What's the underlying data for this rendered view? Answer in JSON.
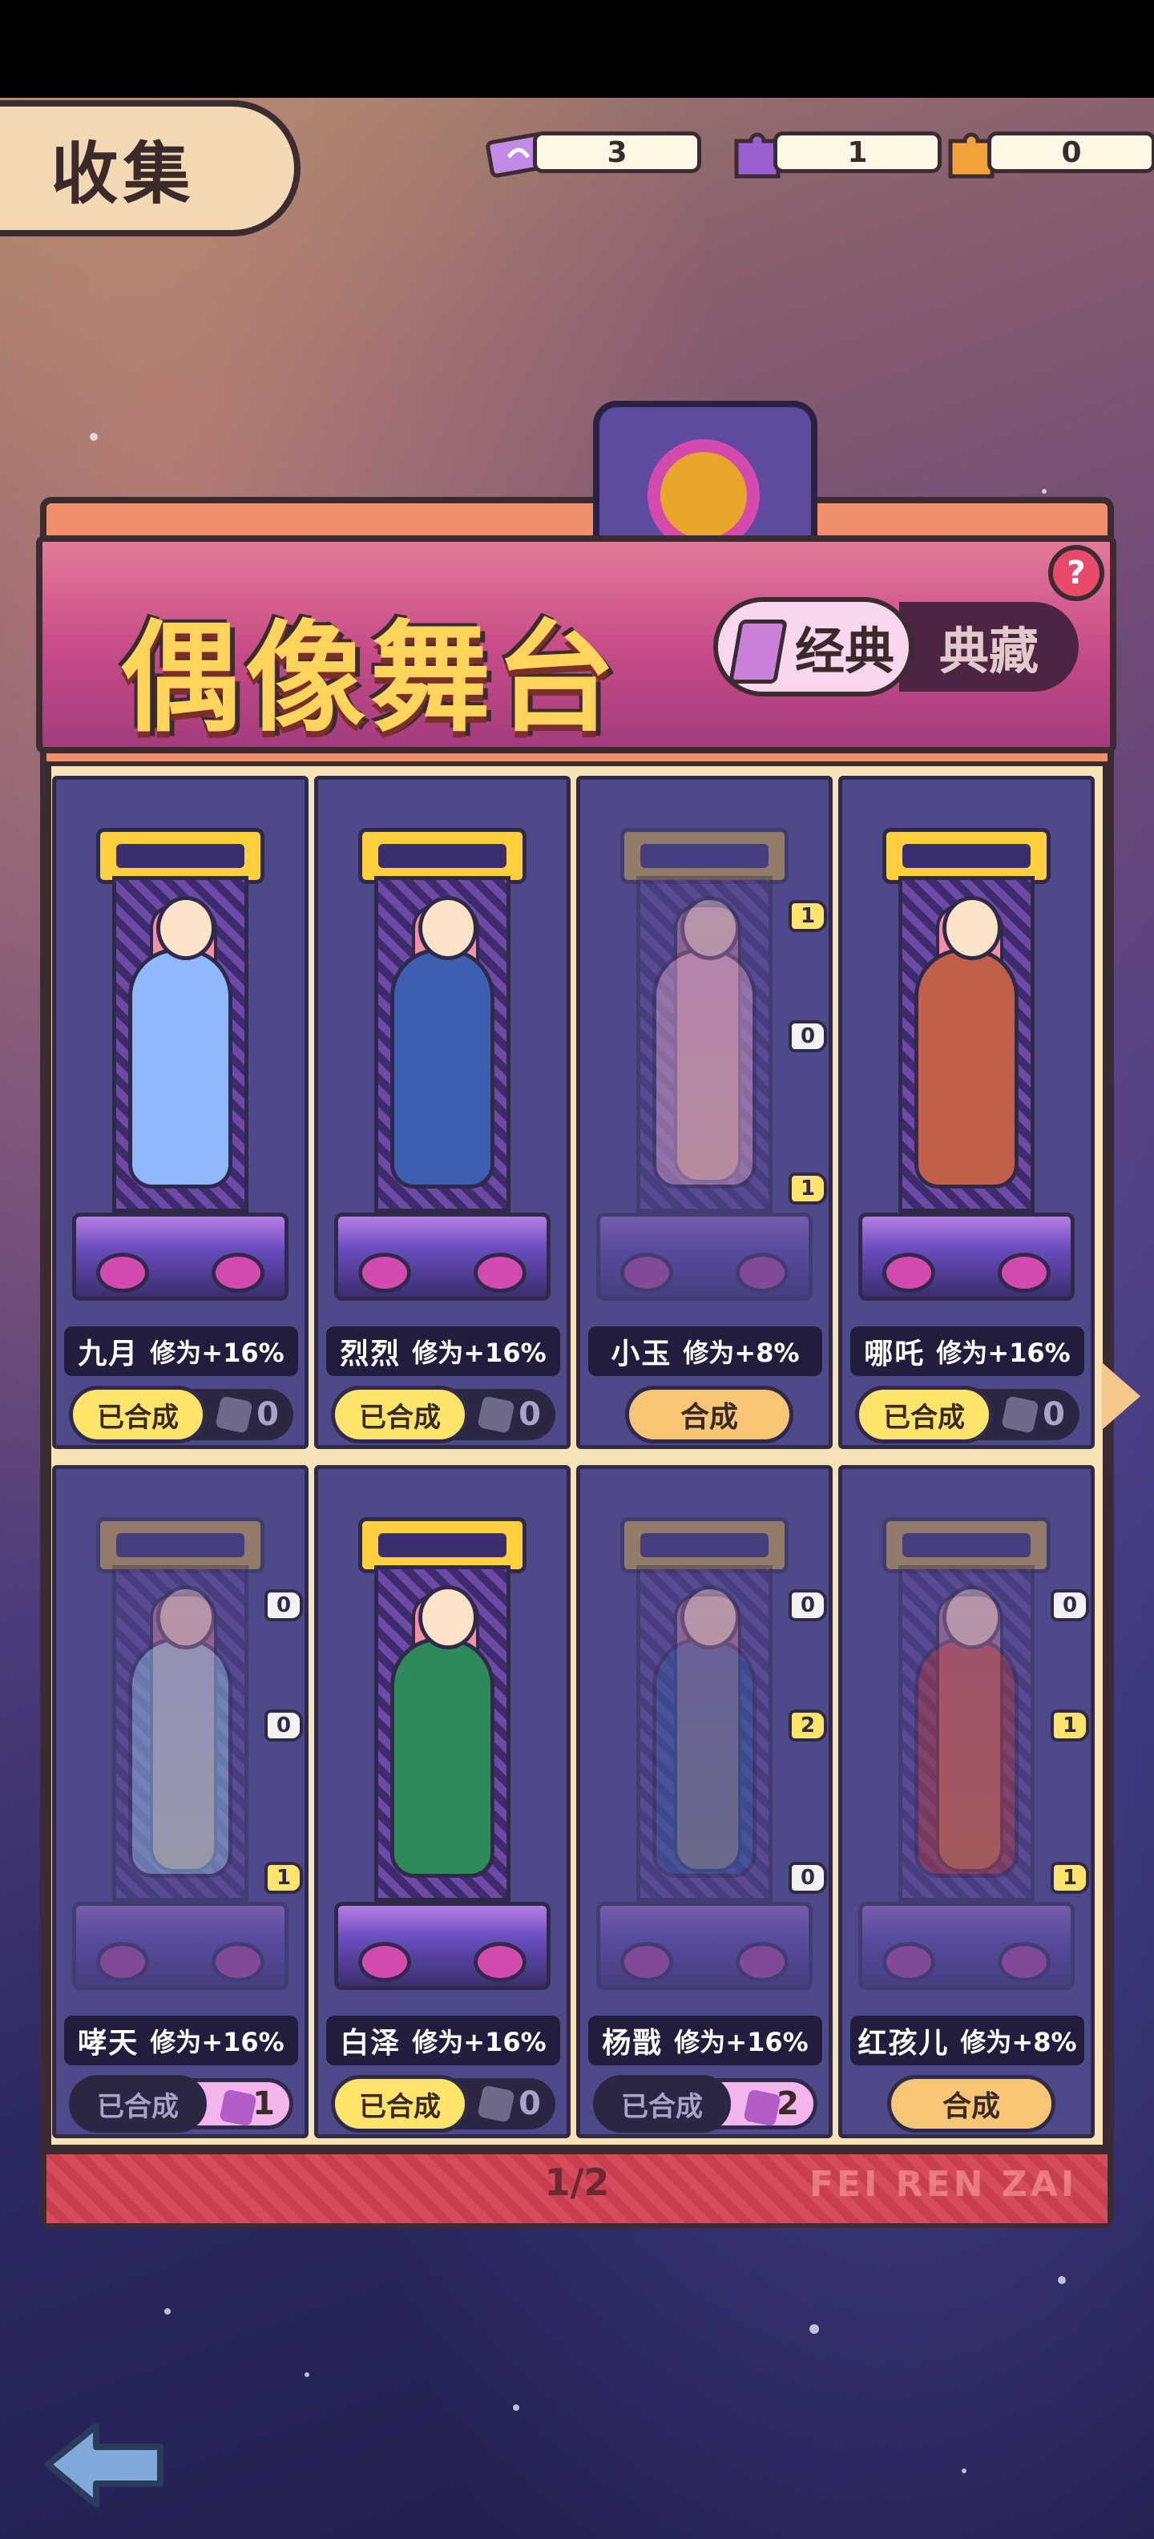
{
  "header": {
    "title": "收集",
    "currencies": [
      {
        "icon": "ticket-icon",
        "value": "3"
      },
      {
        "icon": "purple-puzzle-icon",
        "value": "1"
      },
      {
        "icon": "orange-puzzle-icon",
        "value": "0"
      }
    ]
  },
  "banner": {
    "title": "偶像舞台",
    "tabs": {
      "active": "经典",
      "inactive": "典藏"
    },
    "help": "?"
  },
  "cards": [
    {
      "name": "九月",
      "bonus": "修为+16%",
      "state": "composed",
      "composed_label": "已合成",
      "count": "0"
    },
    {
      "name": "烈烈",
      "bonus": "修为+16%",
      "state": "composed",
      "composed_label": "已合成",
      "count": "0"
    },
    {
      "name": "小玉",
      "bonus": "修为+8%",
      "state": "synth",
      "synth_label": "合成",
      "badges": [
        "1",
        "0",
        "1"
      ]
    },
    {
      "name": "哪吒",
      "bonus": "修为+16%",
      "state": "composed",
      "composed_label": "已合成",
      "count": "0"
    },
    {
      "name": "哮天",
      "bonus": "修为+16%",
      "state": "pending",
      "composed_label": "已合成",
      "count": "1",
      "badges": [
        "0",
        "0",
        "1"
      ]
    },
    {
      "name": "白泽",
      "bonus": "修为+16%",
      "state": "composed",
      "composed_label": "已合成",
      "count": "0"
    },
    {
      "name": "杨戬",
      "bonus": "修为+16%",
      "state": "pending",
      "composed_label": "已合成",
      "count": "2",
      "badges": [
        "0",
        "2",
        "0"
      ]
    },
    {
      "name": "红孩儿",
      "bonus": "修为+8%",
      "state": "synth",
      "synth_label": "合成",
      "badges": [
        "0",
        "1",
        "1"
      ]
    }
  ],
  "footer": {
    "page": "1/2",
    "watermark": "FEI REN ZAI"
  },
  "colors": {
    "accent": "#ffe46b",
    "panel": "#ef8f6a",
    "card": "#4e4a8a"
  }
}
